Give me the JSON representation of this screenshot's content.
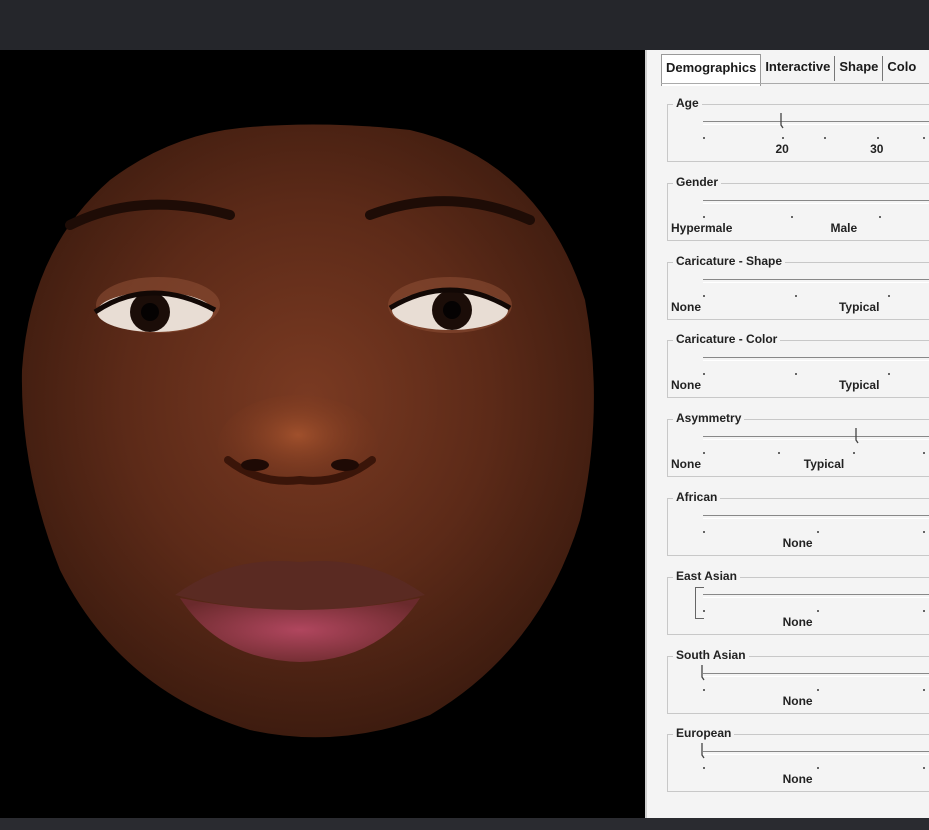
{
  "tabs": [
    "Demographics",
    "Interactive",
    "Shape",
    "Colo"
  ],
  "sliders": [
    {
      "name": "age",
      "label": "Age",
      "thumb": true,
      "bracket": false,
      "labels": [
        {
          "text": "20",
          "pos": 0.36
        },
        {
          "text": "30",
          "pos": 0.79
        }
      ]
    },
    {
      "name": "gender",
      "label": "Gender",
      "thumb": false,
      "bracket": false,
      "labels": [
        {
          "text": "Hypermale",
          "pos": 0.0
        },
        {
          "text": "Male",
          "pos": 0.64
        }
      ]
    },
    {
      "name": "caricature-shape",
      "label": "Caricature - Shape",
      "thumb": false,
      "bracket": false,
      "labels": [
        {
          "text": "None",
          "pos": 0.0
        },
        {
          "text": "Typical",
          "pos": 0.71
        }
      ]
    },
    {
      "name": "caricature-color",
      "label": "Caricature - Color",
      "thumb": false,
      "bracket": false,
      "labels": [
        {
          "text": "None",
          "pos": 0.0
        },
        {
          "text": "Typical",
          "pos": 0.71
        }
      ]
    },
    {
      "name": "asymmetry",
      "label": "Asymmetry",
      "thumb": true,
      "bracket": false,
      "labels": [
        {
          "text": "None",
          "pos": 0.0
        },
        {
          "text": "Typical",
          "pos": 0.55
        }
      ]
    },
    {
      "name": "african",
      "label": "African",
      "thumb": false,
      "bracket": false,
      "labels": [
        {
          "text": "None",
          "pos": 0.43
        }
      ]
    },
    {
      "name": "east-asian",
      "label": "East Asian",
      "thumb": false,
      "bracket": true,
      "labels": [
        {
          "text": "None",
          "pos": 0.43
        }
      ]
    },
    {
      "name": "south-asian",
      "label": "South Asian",
      "thumb": true,
      "bracket": false,
      "labels": [
        {
          "text": "None",
          "pos": 0.43
        }
      ]
    },
    {
      "name": "european",
      "label": "European",
      "thumb": true,
      "bracket": false,
      "labels": [
        {
          "text": "None",
          "pos": 0.43
        }
      ]
    }
  ]
}
